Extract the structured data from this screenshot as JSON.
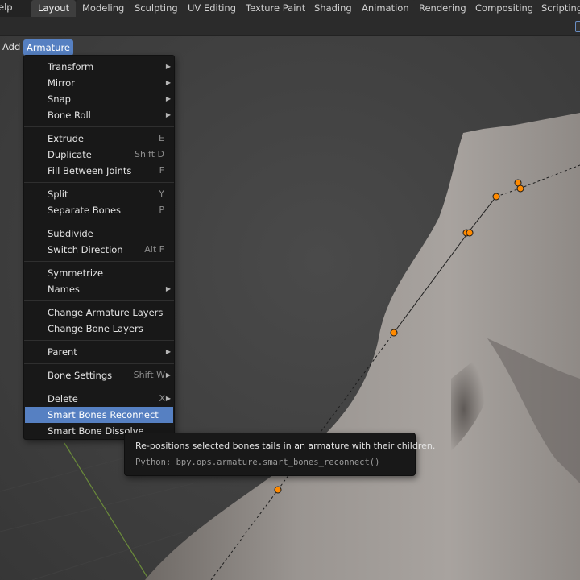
{
  "topbar": {
    "partial_menu": "elp",
    "tabs": [
      {
        "label": "Layout",
        "active": true
      },
      {
        "label": "Modeling",
        "active": false
      },
      {
        "label": "Sculpting",
        "active": false
      },
      {
        "label": "UV Editing",
        "active": false
      },
      {
        "label": "Texture Paint",
        "active": false
      },
      {
        "label": "Shading",
        "active": false
      },
      {
        "label": "Animation",
        "active": false
      },
      {
        "label": "Rendering",
        "active": false
      },
      {
        "label": "Compositing",
        "active": false
      },
      {
        "label": "Scripting",
        "active": false
      }
    ]
  },
  "viewport_header": {
    "add_label": "Add",
    "armature_label": "Armature"
  },
  "armature_menu": {
    "items": [
      {
        "label": "Transform",
        "shortcut": "",
        "submenu": true
      },
      {
        "label": "Mirror",
        "shortcut": "",
        "submenu": true
      },
      {
        "label": "Snap",
        "shortcut": "",
        "submenu": true
      },
      {
        "label": "Bone Roll",
        "shortcut": "",
        "submenu": true
      },
      {
        "label": "Extrude",
        "shortcut": "E",
        "submenu": false
      },
      {
        "label": "Duplicate",
        "shortcut": "Shift D",
        "submenu": false
      },
      {
        "label": "Fill Between Joints",
        "shortcut": "F",
        "submenu": false
      },
      {
        "label": "Split",
        "shortcut": "Y",
        "submenu": false
      },
      {
        "label": "Separate Bones",
        "shortcut": "P",
        "submenu": false
      },
      {
        "label": "Subdivide",
        "shortcut": "",
        "submenu": false
      },
      {
        "label": "Switch Direction",
        "shortcut": "Alt F",
        "submenu": false
      },
      {
        "label": "Symmetrize",
        "shortcut": "",
        "submenu": false
      },
      {
        "label": "Names",
        "shortcut": "",
        "submenu": true
      },
      {
        "label": "Change Armature Layers",
        "shortcut": "",
        "submenu": false
      },
      {
        "label": "Change Bone Layers",
        "shortcut": "",
        "submenu": false
      },
      {
        "label": "Parent",
        "shortcut": "",
        "submenu": true
      },
      {
        "label": "Bone Settings",
        "shortcut": "Shift W",
        "submenu": true
      },
      {
        "label": "Delete",
        "shortcut": "X",
        "submenu": true
      },
      {
        "label": "Smart Bones Reconnect",
        "shortcut": "",
        "submenu": false,
        "highlighted": true
      },
      {
        "label": "Smart Bone Dissolve",
        "shortcut": "",
        "submenu": false
      }
    ]
  },
  "tooltip": {
    "description": "Re-positions selected bones tails in an armature with their children.",
    "python": "Python: bpy.ops.armature.smart_bones_reconnect()"
  },
  "colors": {
    "accent": "#5680c2",
    "menu_bg": "#181818",
    "bone_joint": "#ff8a00"
  }
}
